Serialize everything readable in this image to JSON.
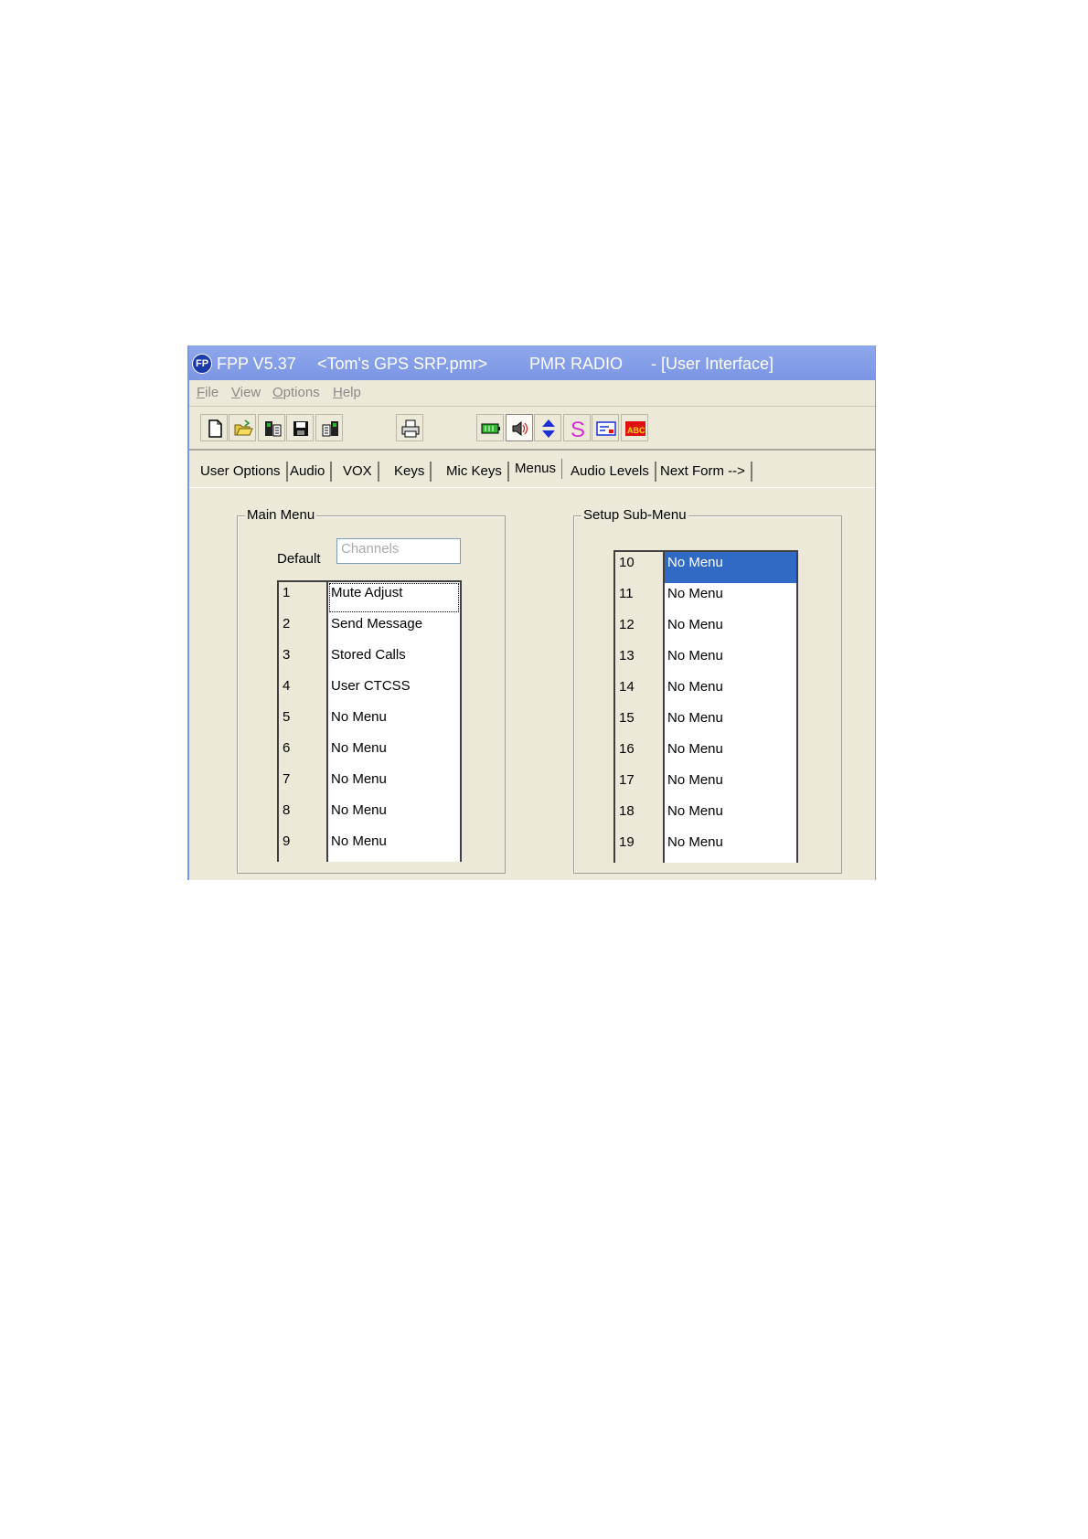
{
  "window": {
    "app_name": "FPP V5.37",
    "file_name": "<Tom's GPS SRP.pmr>",
    "radio_type": "PMR RADIO",
    "form_name": "- [User Interface]",
    "icon_text": "FP"
  },
  "menu": [
    "File",
    "View",
    "Options",
    "Help"
  ],
  "toolbar": {
    "buttons": [
      "new-file-icon",
      "open-folder-icon",
      "read-radio-icon",
      "save-icon",
      "write-radio-icon",
      "print-icon",
      "battery-icon",
      "speaker-icon",
      "up-down-arrows-icon",
      "s-icon",
      "form-icon",
      "abc-icon"
    ],
    "colors": {
      "battery": "#2fb82f",
      "arrows": "#1d2fd6",
      "s": "#d22ed2",
      "abc": "#e01010"
    },
    "abc_text": "ABC"
  },
  "tabs": [
    "User Options",
    "Audio",
    "VOX",
    "Keys",
    "Mic Keys",
    "Menus",
    "Audio Levels",
    "Next Form -->"
  ],
  "active_tab": "Menus",
  "main_menu": {
    "title": "Main Menu",
    "default_label": "Default",
    "default_value": "Channels",
    "rows": [
      {
        "num": "1",
        "value": "Mute Adjust"
      },
      {
        "num": "2",
        "value": "Send Message"
      },
      {
        "num": "3",
        "value": "Stored Calls"
      },
      {
        "num": "4",
        "value": "User CTCSS"
      },
      {
        "num": "5",
        "value": "No Menu"
      },
      {
        "num": "6",
        "value": "No Menu"
      },
      {
        "num": "7",
        "value": "No Menu"
      },
      {
        "num": "8",
        "value": "No Menu"
      },
      {
        "num": "9",
        "value": "No Menu"
      }
    ]
  },
  "setup_sub_menu": {
    "title": "Setup Sub-Menu",
    "rows": [
      {
        "num": "10",
        "value": "No Menu"
      },
      {
        "num": "11",
        "value": "No Menu"
      },
      {
        "num": "12",
        "value": "No Menu"
      },
      {
        "num": "13",
        "value": "No Menu"
      },
      {
        "num": "14",
        "value": "No Menu"
      },
      {
        "num": "15",
        "value": "No Menu"
      },
      {
        "num": "16",
        "value": "No Menu"
      },
      {
        "num": "17",
        "value": "No Menu"
      },
      {
        "num": "18",
        "value": "No Menu"
      },
      {
        "num": "19",
        "value": "No Menu"
      }
    ]
  }
}
